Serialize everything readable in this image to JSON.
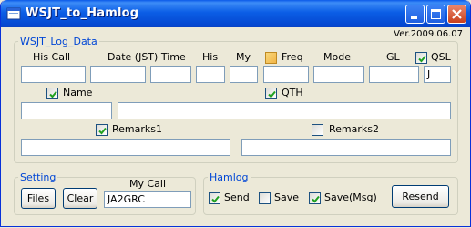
{
  "window": {
    "title": "WSJT_to_Hamlog",
    "version": "Ver.2009.06.07"
  },
  "log_data": {
    "group_label": "WSJT_Log_Data",
    "headers": {
      "his_call": "His Call",
      "date_time": "Date (JST) Time",
      "his": "His",
      "my": "My",
      "freq": "Freq",
      "mode": "Mode",
      "gl": "GL",
      "qsl": "QSL"
    },
    "checks": {
      "freq": false,
      "qsl": true,
      "name": true,
      "qth": true,
      "remarks1": true,
      "remarks2": false
    },
    "fields": {
      "his_call": "",
      "date": "",
      "time": "",
      "his": "",
      "my": "",
      "freq": "",
      "mode": "",
      "gl": "",
      "qsl": "J",
      "name": "",
      "qth": "",
      "remarks1": "",
      "remarks2": ""
    },
    "labels": {
      "name": "Name",
      "qth": "QTH",
      "remarks1": "Remarks1",
      "remarks2": "Remarks2"
    }
  },
  "setting": {
    "group_label": "Setting",
    "my_call_label": "My Call",
    "my_call": "JA2GRC",
    "files_button": "Files",
    "clear_button": "Clear"
  },
  "hamlog": {
    "group_label": "Hamlog",
    "send_label": "Send",
    "save_label": "Save",
    "save_msg_label": "Save(Msg)",
    "resend_button": "Resend",
    "send_checked": true,
    "save_checked": false,
    "save_msg_checked": true
  },
  "icons": {
    "app": "app-window-icon",
    "minimize": "minimize-icon",
    "maximize": "maximize-icon",
    "close": "close-icon",
    "check": "checkmark-icon"
  }
}
